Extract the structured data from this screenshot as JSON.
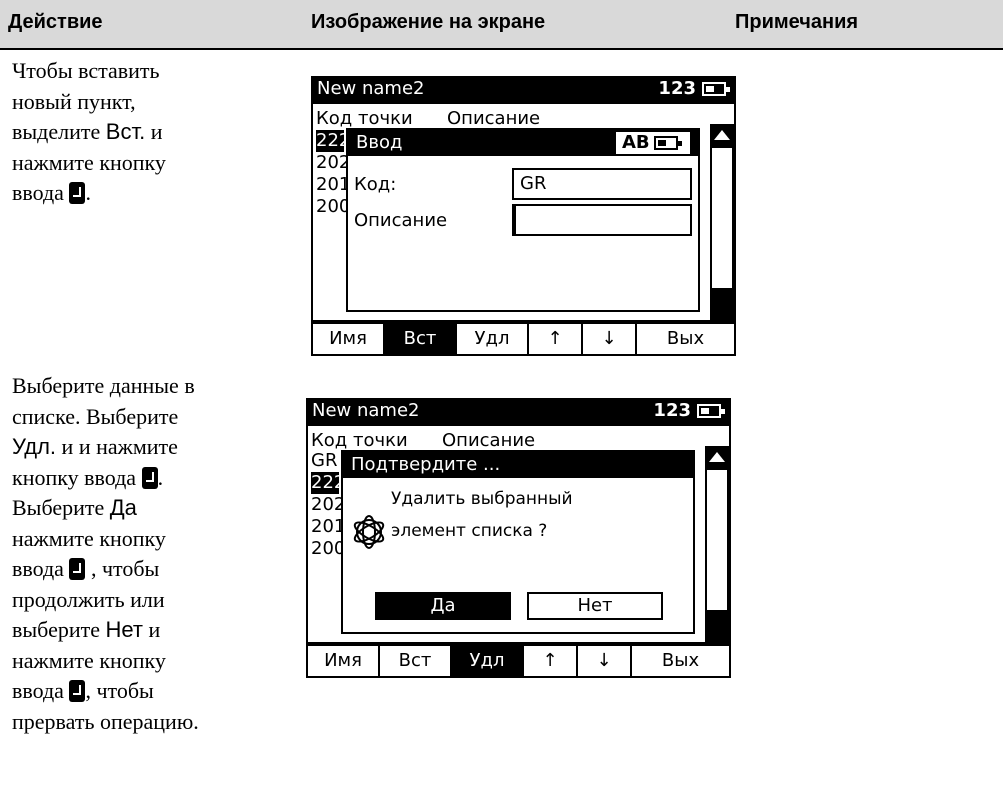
{
  "header": {
    "col1": "Действие",
    "col2": "Изображение на экране",
    "col3": "Примечания"
  },
  "step1": {
    "line1": "Чтобы вставить",
    "line2": "новый пункт,",
    "line3_a": "выделите ",
    "line3_key": "Вст.",
    "line3_b": " и",
    "line4": "нажмите кнопку",
    "line5": "ввода "
  },
  "step2": {
    "line1": "Выберите данные в",
    "line2": "списке. Выберите",
    "line3_key": "Удл.",
    "line3_b": " и и нажмите",
    "line4": "кнопку ввода ",
    "line5_a": "Выберите ",
    "line5_key": "Да",
    "line6": "нажмите кнопку",
    "line7_a": "ввода ",
    "line7_b": " , чтобы",
    "line8": "продолжить или",
    "line9_a": "выберите ",
    "line9_key": "Нет",
    "line9_b": " и",
    "line10": "нажмите кнопку",
    "line11_a": "ввода ",
    "line11_b": ", чтобы",
    "line12": "прервать операцию."
  },
  "screen1": {
    "title": "New name2",
    "mode": "123",
    "list_header_code": "Код точки",
    "list_header_desc": "Описание",
    "list_rows": [
      "222",
      "202",
      "201",
      "200"
    ],
    "dialog_title": "Ввод",
    "dialog_mode": "AB",
    "code_label": "Код:",
    "code_value": "GR",
    "desc_label": "Описание",
    "desc_value": "",
    "softkeys": [
      "Имя",
      "Вст",
      "Удл",
      "↑",
      "↓",
      "Вых"
    ]
  },
  "screen2": {
    "title": "New name2",
    "mode": "123",
    "list_header_code": "Код точки",
    "list_header_desc": "Описание",
    "list_rows": [
      "GR",
      "222",
      "202",
      "201",
      "200"
    ],
    "dialog_title": "Подтвердите ...",
    "message_line1": "Удалить выбранный",
    "message_line2": "элемент списка ?",
    "yes": "Да",
    "no": "Нет",
    "softkeys": [
      "Имя",
      "Вст",
      "Удл",
      "↑",
      "↓",
      "Вых"
    ]
  },
  "icons": {
    "enter_key": "enter-key-icon",
    "battery": "battery-icon",
    "logo": "trimble-globe-icon"
  }
}
